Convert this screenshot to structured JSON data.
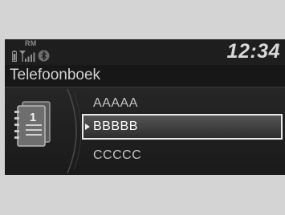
{
  "status": {
    "rm_label": "RM",
    "clock": "12:34",
    "icons": [
      "phone-battery-icon",
      "signal-strength-icon",
      "bluetooth-icon"
    ]
  },
  "header": {
    "title": "Telefoonboek"
  },
  "phonebook": {
    "icon": "phonebook-icon",
    "icon_number": "1",
    "items": [
      {
        "label": "AAAAA",
        "selected": false
      },
      {
        "label": "BBBBB",
        "selected": true
      },
      {
        "label": "CCCCC",
        "selected": false
      }
    ]
  },
  "colors": {
    "screen_bg": "#1e1e1e",
    "frame": "#d4d4d4",
    "text": "#c4c4c4",
    "highlight_border": "#e8e8e8"
  }
}
